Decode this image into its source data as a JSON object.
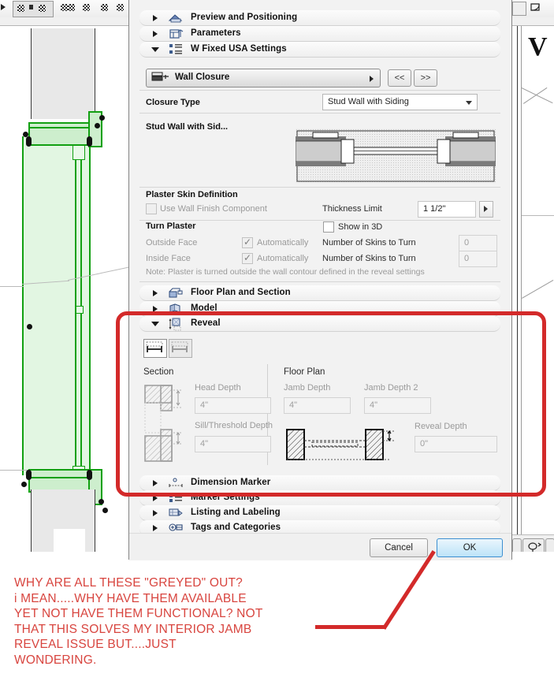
{
  "dialog": {
    "sections": [
      {
        "label": "Preview and Positioning",
        "icon": "preview-positioning-icon",
        "expanded": false
      },
      {
        "label": "Parameters",
        "icon": "parameters-icon",
        "expanded": false
      },
      {
        "label": "W Fixed USA Settings",
        "icon": "settings-icon",
        "expanded": true
      },
      {
        "label": "Floor Plan and Section",
        "icon": "floor-plan-section-icon",
        "expanded": false
      },
      {
        "label": "Model",
        "icon": "model-icon",
        "expanded": false
      },
      {
        "label": "Reveal",
        "icon": "reveal-icon",
        "expanded": true
      },
      {
        "label": "Dimension Marker",
        "icon": "dimension-marker-icon",
        "expanded": false
      },
      {
        "label": "Marker Settings",
        "icon": "marker-settings-icon",
        "expanded": false
      },
      {
        "label": "Listing and Labeling",
        "icon": "listing-labeling-icon",
        "expanded": false
      },
      {
        "label": "Tags and Categories",
        "icon": "tags-categories-icon",
        "expanded": false
      }
    ],
    "wall_closure": {
      "button_label": "Wall Closure",
      "prev_label": "<<",
      "next_label": ">>"
    },
    "closure_type": {
      "label": "Closure Type",
      "value": "Stud Wall with Siding"
    },
    "preview": {
      "title": "Stud Wall with Sid..."
    },
    "plaster": {
      "heading": "Plaster Skin Definition",
      "use_wall_finish_label": "Use Wall Finish Component",
      "use_wall_finish_checked": false,
      "thickness_limit_label": "Thickness Limit",
      "thickness_limit_value": "1 1/2\"",
      "turn_plaster_heading": "Turn Plaster",
      "show_in_3d_label": "Show in 3D",
      "show_in_3d_checked": false,
      "rows": [
        {
          "face": "Outside Face",
          "auto_label": "Automatically",
          "auto_checked": true,
          "skins_label": "Number of Skins to Turn",
          "skins_value": "0"
        },
        {
          "face": "Inside Face",
          "auto_label": "Automatically",
          "auto_checked": true,
          "skins_label": "Number of Skins to Turn",
          "skins_value": "0"
        }
      ],
      "note": "Note: Plaster is turned outside the wall contour defined in the reveal settings"
    },
    "reveal": {
      "section_heading": "Section",
      "floor_plan_heading": "Floor Plan",
      "head_depth_label": "Head Depth",
      "head_depth_value": "4\"",
      "sill_threshold_label": "Sill/Threshold Depth",
      "sill_threshold_value": "4\"",
      "jamb_depth_label": "Jamb Depth",
      "jamb_depth_value": "4\"",
      "jamb_depth2_label": "Jamb Depth 2",
      "jamb_depth2_value": "4\"",
      "reveal_depth_label": "Reveal Depth",
      "reveal_depth_value": "0\""
    },
    "buttons": {
      "cancel": "Cancel",
      "ok": "OK"
    }
  },
  "annotation": {
    "color": "#d8453f",
    "lines": [
      "WHY ARE ALL THESE \"GREYED\" OUT?",
      "i MEAN.....WHY HAVE THEM AVAILABLE",
      "YET NOT HAVE THEM FUNCTIONAL? NOT",
      "THAT THIS SOLVES MY INTERIOR JAMB",
      "REVEAL ISSUE BUT....JUST",
      "WONDERING."
    ]
  },
  "colors": {
    "annotation_red": "#d32a2a",
    "selection_green": "#12a012",
    "dialog_bg": "#f2f2f2",
    "ok_blue": "#bde3f8"
  }
}
